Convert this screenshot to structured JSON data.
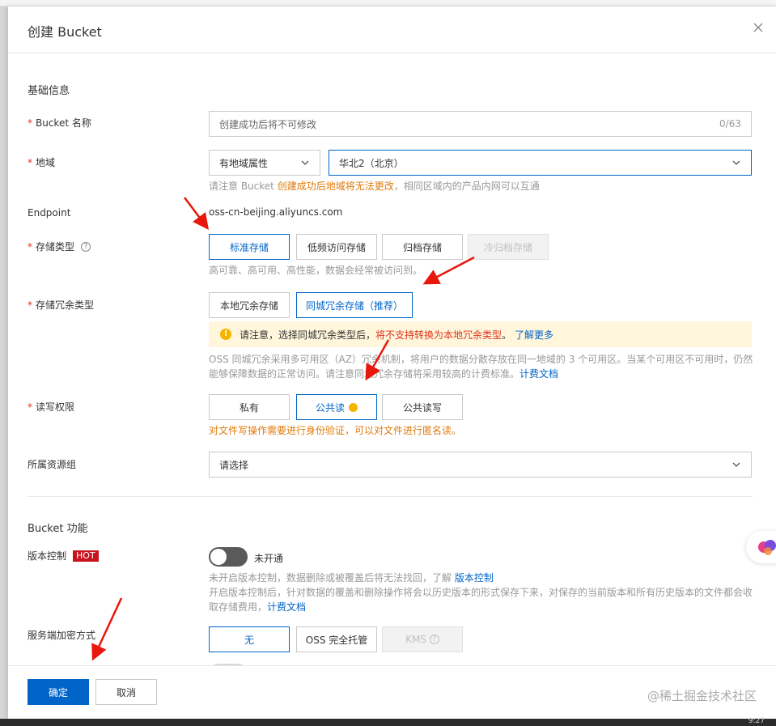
{
  "dialog": {
    "title": "创建 Bucket"
  },
  "basic": {
    "section_title": "基础信息",
    "bucket_name": {
      "label": "Bucket 名称",
      "placeholder": "创建成功后将不可修改",
      "counter": "0/63"
    },
    "region": {
      "label": "地域",
      "attr_select": "有地域属性",
      "region_select": "华北2（北京）",
      "hint_prefix": "请注意 Bucket ",
      "hint_warn": "创建成功后地域将无法更改",
      "hint_suffix": "，相同区域内的产品内网可以互通"
    },
    "endpoint": {
      "label": "Endpoint",
      "value": "oss-cn-beijing.aliyuncs.com"
    },
    "storage_class": {
      "label": "存储类型",
      "help": "?",
      "options": [
        "标准存储",
        "低频访问存储",
        "归档存储",
        "冷归档存储"
      ],
      "hint": "高可靠、高可用、高性能，数据会经常被访问到。"
    },
    "redundancy": {
      "label": "存储冗余类型",
      "options": [
        "本地冗余存储",
        "同城冗余存储（推荐）"
      ],
      "alert_prefix": "请注意，选择同城冗余类型后，",
      "alert_warn": "将不支持转换为本地冗余类型",
      "alert_suffix": "。",
      "alert_link": "了解更多",
      "desc": "OSS 同城冗余采用多可用区（AZ）冗余机制，将用户的数据分散存放在同一地域的 3 个可用区。当某个可用区不可用时，仍然能够保障数据的正常访问。请注意同城冗余存储将采用较高的计费标准。",
      "desc_link": "计费文档"
    },
    "acl": {
      "label": "读写权限",
      "options": [
        "私有",
        "公共读",
        "公共读写"
      ],
      "warn": "对文件写操作需要进行身份验证，可以对文件进行匿名读。"
    },
    "resource_group": {
      "label": "所属资源组",
      "placeholder": "请选择"
    }
  },
  "features": {
    "section_title": "Bucket 功能",
    "versioning": {
      "label": "版本控制",
      "badge": "HOT",
      "state": "未开通",
      "hint1_prefix": "未开启版本控制，数据删除或被覆盖后将无法找回，了解 ",
      "hint1_link": "版本控制",
      "hint2": "开启版本控制后，针对数据的覆盖和删除操作将会以历史版本的形式保存下来，对保存的当前版本和所有历史版本的文件都会收取存储费用，",
      "hint2_link": "计费文档"
    },
    "encryption": {
      "label": "服务端加密方式",
      "options": [
        "无",
        "OSS 完全托管",
        "KMS"
      ],
      "kms_help": "?"
    }
  },
  "footer": {
    "confirm": "确定",
    "cancel": "取消",
    "watermark": "@稀土掘金技术社区"
  },
  "taskbar": {
    "clock": "9:27"
  },
  "colors": {
    "primary": "#0064c8",
    "warning": "#e07a0a",
    "required": "#e0341b",
    "hot": "#c8141e",
    "annotation_arrow": "#e8170c"
  }
}
